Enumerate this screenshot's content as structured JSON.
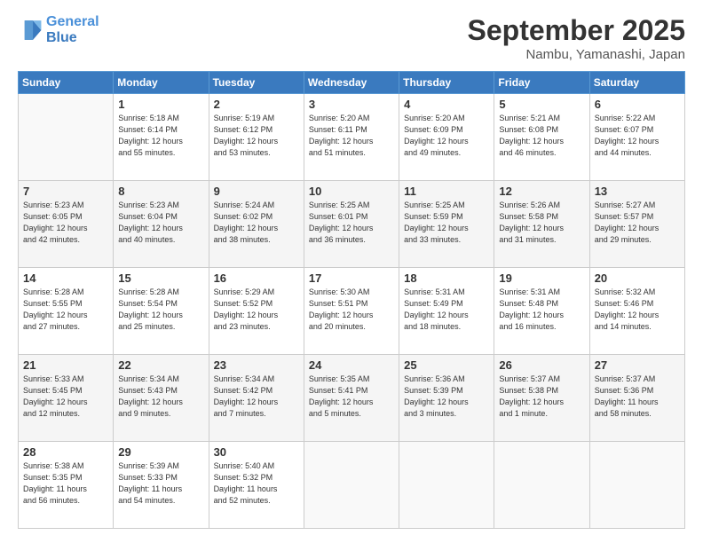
{
  "logo": {
    "line1": "General",
    "line2": "Blue"
  },
  "title": "September 2025",
  "location": "Nambu, Yamanashi, Japan",
  "weekdays": [
    "Sunday",
    "Monday",
    "Tuesday",
    "Wednesday",
    "Thursday",
    "Friday",
    "Saturday"
  ],
  "weeks": [
    [
      {
        "day": "",
        "info": ""
      },
      {
        "day": "1",
        "info": "Sunrise: 5:18 AM\nSunset: 6:14 PM\nDaylight: 12 hours\nand 55 minutes."
      },
      {
        "day": "2",
        "info": "Sunrise: 5:19 AM\nSunset: 6:12 PM\nDaylight: 12 hours\nand 53 minutes."
      },
      {
        "day": "3",
        "info": "Sunrise: 5:20 AM\nSunset: 6:11 PM\nDaylight: 12 hours\nand 51 minutes."
      },
      {
        "day": "4",
        "info": "Sunrise: 5:20 AM\nSunset: 6:09 PM\nDaylight: 12 hours\nand 49 minutes."
      },
      {
        "day": "5",
        "info": "Sunrise: 5:21 AM\nSunset: 6:08 PM\nDaylight: 12 hours\nand 46 minutes."
      },
      {
        "day": "6",
        "info": "Sunrise: 5:22 AM\nSunset: 6:07 PM\nDaylight: 12 hours\nand 44 minutes."
      }
    ],
    [
      {
        "day": "7",
        "info": "Sunrise: 5:23 AM\nSunset: 6:05 PM\nDaylight: 12 hours\nand 42 minutes."
      },
      {
        "day": "8",
        "info": "Sunrise: 5:23 AM\nSunset: 6:04 PM\nDaylight: 12 hours\nand 40 minutes."
      },
      {
        "day": "9",
        "info": "Sunrise: 5:24 AM\nSunset: 6:02 PM\nDaylight: 12 hours\nand 38 minutes."
      },
      {
        "day": "10",
        "info": "Sunrise: 5:25 AM\nSunset: 6:01 PM\nDaylight: 12 hours\nand 36 minutes."
      },
      {
        "day": "11",
        "info": "Sunrise: 5:25 AM\nSunset: 5:59 PM\nDaylight: 12 hours\nand 33 minutes."
      },
      {
        "day": "12",
        "info": "Sunrise: 5:26 AM\nSunset: 5:58 PM\nDaylight: 12 hours\nand 31 minutes."
      },
      {
        "day": "13",
        "info": "Sunrise: 5:27 AM\nSunset: 5:57 PM\nDaylight: 12 hours\nand 29 minutes."
      }
    ],
    [
      {
        "day": "14",
        "info": "Sunrise: 5:28 AM\nSunset: 5:55 PM\nDaylight: 12 hours\nand 27 minutes."
      },
      {
        "day": "15",
        "info": "Sunrise: 5:28 AM\nSunset: 5:54 PM\nDaylight: 12 hours\nand 25 minutes."
      },
      {
        "day": "16",
        "info": "Sunrise: 5:29 AM\nSunset: 5:52 PM\nDaylight: 12 hours\nand 23 minutes."
      },
      {
        "day": "17",
        "info": "Sunrise: 5:30 AM\nSunset: 5:51 PM\nDaylight: 12 hours\nand 20 minutes."
      },
      {
        "day": "18",
        "info": "Sunrise: 5:31 AM\nSunset: 5:49 PM\nDaylight: 12 hours\nand 18 minutes."
      },
      {
        "day": "19",
        "info": "Sunrise: 5:31 AM\nSunset: 5:48 PM\nDaylight: 12 hours\nand 16 minutes."
      },
      {
        "day": "20",
        "info": "Sunrise: 5:32 AM\nSunset: 5:46 PM\nDaylight: 12 hours\nand 14 minutes."
      }
    ],
    [
      {
        "day": "21",
        "info": "Sunrise: 5:33 AM\nSunset: 5:45 PM\nDaylight: 12 hours\nand 12 minutes."
      },
      {
        "day": "22",
        "info": "Sunrise: 5:34 AM\nSunset: 5:43 PM\nDaylight: 12 hours\nand 9 minutes."
      },
      {
        "day": "23",
        "info": "Sunrise: 5:34 AM\nSunset: 5:42 PM\nDaylight: 12 hours\nand 7 minutes."
      },
      {
        "day": "24",
        "info": "Sunrise: 5:35 AM\nSunset: 5:41 PM\nDaylight: 12 hours\nand 5 minutes."
      },
      {
        "day": "25",
        "info": "Sunrise: 5:36 AM\nSunset: 5:39 PM\nDaylight: 12 hours\nand 3 minutes."
      },
      {
        "day": "26",
        "info": "Sunrise: 5:37 AM\nSunset: 5:38 PM\nDaylight: 12 hours\nand 1 minute."
      },
      {
        "day": "27",
        "info": "Sunrise: 5:37 AM\nSunset: 5:36 PM\nDaylight: 11 hours\nand 58 minutes."
      }
    ],
    [
      {
        "day": "28",
        "info": "Sunrise: 5:38 AM\nSunset: 5:35 PM\nDaylight: 11 hours\nand 56 minutes."
      },
      {
        "day": "29",
        "info": "Sunrise: 5:39 AM\nSunset: 5:33 PM\nDaylight: 11 hours\nand 54 minutes."
      },
      {
        "day": "30",
        "info": "Sunrise: 5:40 AM\nSunset: 5:32 PM\nDaylight: 11 hours\nand 52 minutes."
      },
      {
        "day": "",
        "info": ""
      },
      {
        "day": "",
        "info": ""
      },
      {
        "day": "",
        "info": ""
      },
      {
        "day": "",
        "info": ""
      }
    ]
  ]
}
